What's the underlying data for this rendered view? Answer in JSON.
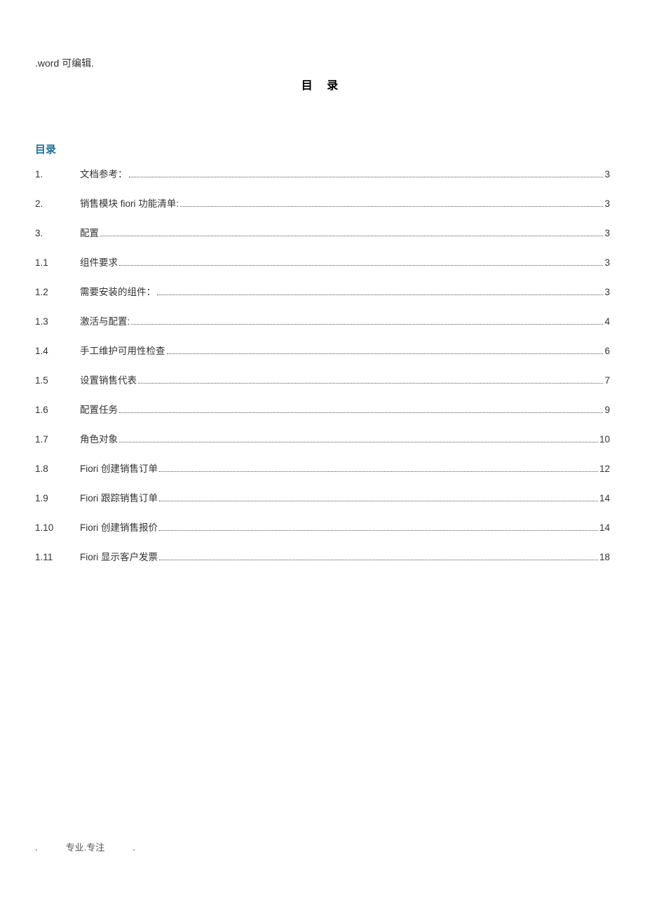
{
  "header": ".word 可编辑.",
  "title": "目 录",
  "toc_heading": "目录",
  "entries": [
    {
      "num": "1.",
      "label": "文档参考：",
      "page": "3"
    },
    {
      "num": "2.",
      "label": "销售模块 fiori 功能清单:",
      "page": "3"
    },
    {
      "num": "3.",
      "label": "配置",
      "page": "3"
    },
    {
      "num": "1.1",
      "label": "组件要求",
      "page": "3"
    },
    {
      "num": "1.2",
      "label": "需要安装的组件：",
      "page": "3"
    },
    {
      "num": "1.3",
      "label": "激活与配置:",
      "page": "4"
    },
    {
      "num": "1.4",
      "label": "手工维护可用性检查",
      "page": "6"
    },
    {
      "num": "1.5",
      "label": "设置销售代表",
      "page": "7"
    },
    {
      "num": "1.6",
      "label": "配置任务",
      "page": "9"
    },
    {
      "num": "1.7",
      "label": "角色对象",
      "page": "10"
    },
    {
      "num": "1.8",
      "label": "Fiori 创建销售订单",
      "page": "12"
    },
    {
      "num": "1.9",
      "label": "Fiori 跟踪销售订单",
      "page": "14"
    },
    {
      "num": "1.10",
      "label": "Fiori 创建销售报价",
      "page": "14"
    },
    {
      "num": "1.11",
      "label": "Fiori 显示客户发票",
      "page": "18"
    }
  ],
  "footer": {
    "left": ".",
    "mid": "专业.专注",
    "right": "."
  }
}
